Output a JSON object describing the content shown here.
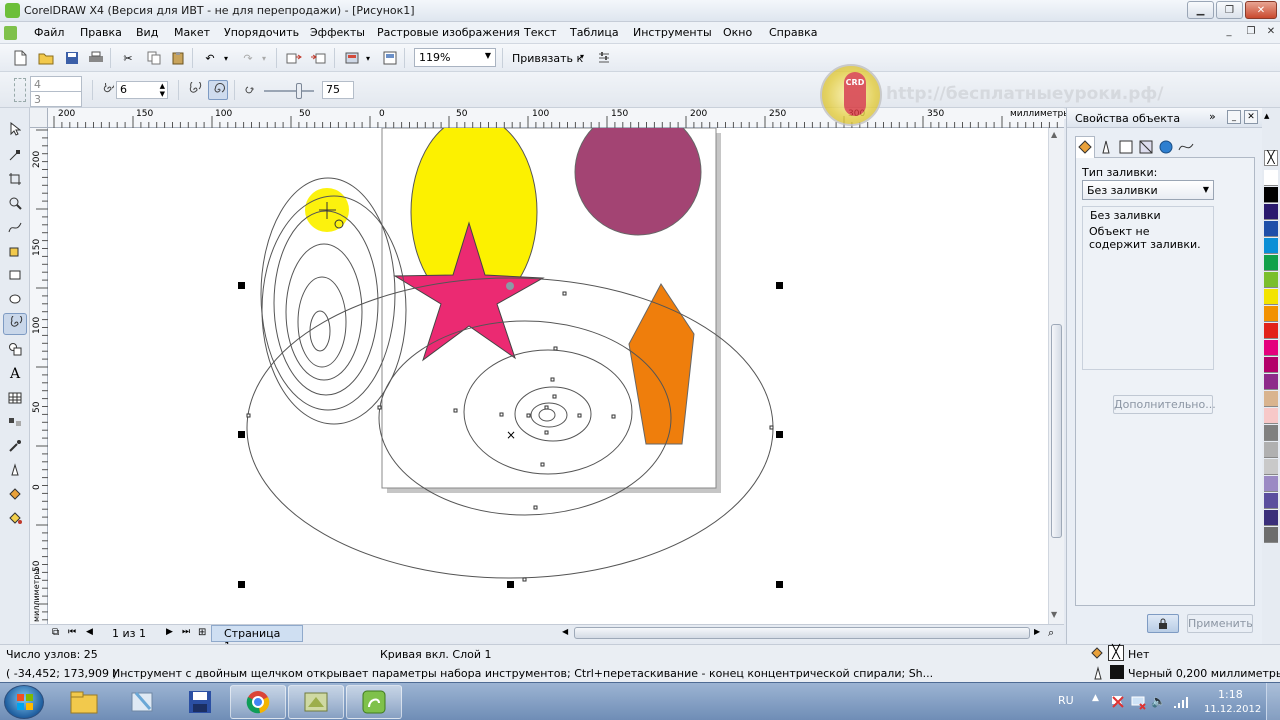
{
  "app": {
    "title": "CorelDRAW X4 (Версия для ИВТ - не для перепродажи) - [Рисунок1]"
  },
  "menu": [
    "Файл",
    "Правка",
    "Вид",
    "Макет",
    "Упорядочить",
    "Эффекты",
    "Растровые изображения",
    "Текст",
    "Таблица",
    "Инструменты",
    "Окно",
    "Справка"
  ],
  "toolbar": {
    "zoom": "119%",
    "snap_label": "Привязать к"
  },
  "property_bar": {
    "width_value": "4",
    "height_value": "3",
    "revolutions": "6",
    "expansion": "75"
  },
  "watermark": {
    "text": "http://бесплатныеуроки.рф/",
    "logo_text": "CRD"
  },
  "ruler": {
    "h_ticks": [
      "200",
      "150",
      "100",
      "50",
      "0",
      "50",
      "100",
      "150",
      "200",
      "250",
      "300",
      "350"
    ],
    "h_units": "миллиметры",
    "v_ticks": [
      "200",
      "150",
      "100",
      "50",
      "0",
      "50"
    ],
    "v_units": "миллиметры"
  },
  "page_nav": {
    "count": "1 из 1",
    "tab": "Страница 1"
  },
  "docker": {
    "title": "Свойства объекта",
    "fill_type_label": "Тип заливки:",
    "fill_type_value": "Без заливки",
    "desc_title": "Без заливки",
    "desc_text": "Объект не содержит заливки.",
    "more_button": "Дополнительно...",
    "apply_button": "Применить"
  },
  "palette": {
    "colors": [
      "#ffffff",
      "#000000",
      "#2a1a6e",
      "#1f4fa8",
      "#0b8fd6",
      "#12a14a",
      "#7bbf2c",
      "#f3e400",
      "#f29100",
      "#e2231a",
      "#e4007d",
      "#b3006a",
      "#8e2a8a",
      "#d9b48f",
      "#f7c8c8",
      "#808080",
      "#b0b0b0",
      "#c9c9c9",
      "#9b8ac4",
      "#5b4e9e",
      "#3a2f7a",
      "#6d6d6d"
    ]
  },
  "status": {
    "nodes": "Число узлов: 25",
    "object": "Кривая вкл. Слой 1",
    "coords": "( -34,452; 173,909 )",
    "hint": "Инструмент с двойным щелчком открывает параметры набора инструментов; Ctrl+перетаскивание - конец концентрической спирали; Sh...",
    "fill": "Нет",
    "outline": "Черный  0,200 миллиметры"
  },
  "taskbar": {
    "lang": "RU",
    "time": "1:18",
    "date": "11.12.2012"
  },
  "colors": {
    "yellow": "#fcf100",
    "plum": "#a34473",
    "star": "#eb2a72",
    "orange": "#ef7e0c"
  }
}
